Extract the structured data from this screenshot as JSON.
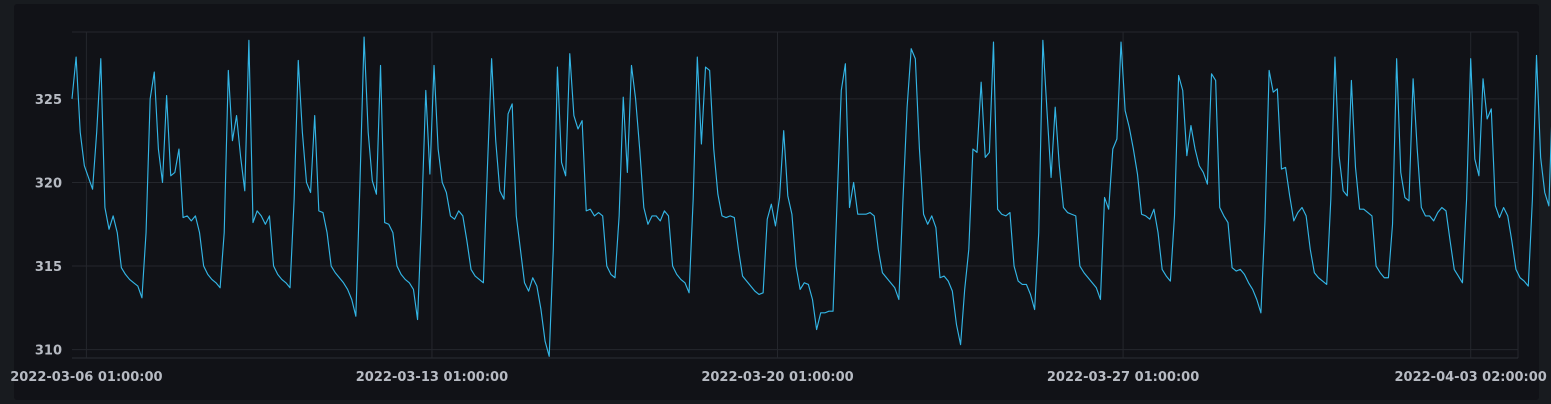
{
  "chart_data": {
    "type": "line",
    "title": "",
    "xlabel": "",
    "ylabel": "",
    "x_range": [
      "2022-03-05T18:00:00",
      "2022-04-04T01:00:00"
    ],
    "ylim": [
      309.5,
      329
    ],
    "y_ticks": [
      "310",
      "315",
      "320",
      "325"
    ],
    "x_ticks": [
      {
        "t": "2022-03-06T01:00:00",
        "label": "2022-03-06 01:00:00"
      },
      {
        "t": "2022-03-13T01:00:00",
        "label": "2022-03-13 01:00:00"
      },
      {
        "t": "2022-03-20T01:00:00",
        "label": "2022-03-20 01:00:00"
      },
      {
        "t": "2022-03-27T01:00:00",
        "label": "2022-03-27 01:00:00"
      },
      {
        "t": "2022-04-03T02:00:00",
        "label": "2022-04-03 02:00:00"
      }
    ],
    "grid": true,
    "line_color": "#33b5e5",
    "series": [
      {
        "sample_interval_hours": 2,
        "start": "2022-03-05T18:00:00",
        "values": [
          325,
          327.5,
          323,
          321,
          320.3,
          319.6,
          323,
          327.4,
          318.5,
          317.2,
          318,
          317,
          314.9,
          314.5,
          314.2,
          314,
          313.8,
          313.1,
          317,
          325,
          326.6,
          322,
          320,
          325.2,
          320.4,
          320.6,
          322,
          317.9,
          318,
          317.7,
          318,
          317,
          315,
          314.5,
          314.2,
          314,
          313.7,
          317,
          326.7,
          322.5,
          324,
          321.5,
          319.5,
          328.5,
          317.6,
          318.3,
          318,
          317.5,
          318,
          315,
          314.5,
          314.2,
          314,
          313.7,
          319,
          327.3,
          323,
          320,
          319.4,
          324,
          318.3,
          318.2,
          317,
          315,
          314.6,
          314.3,
          314,
          313.6,
          313,
          312,
          320,
          328.7,
          323,
          320.1,
          319.3,
          327,
          317.6,
          317.5,
          317,
          315,
          314.5,
          314.2,
          314,
          313.6,
          311.8,
          318,
          325.5,
          320.5,
          327,
          322,
          320,
          319.4,
          318,
          317.8,
          318.3,
          318,
          316.5,
          314.8,
          314.4,
          314.2,
          314,
          321,
          327.4,
          322.5,
          319.5,
          319,
          324.1,
          324.7,
          318,
          316,
          314,
          313.5,
          314.3,
          313.8,
          312.4,
          310.5,
          309.6,
          316,
          326.9,
          321.2,
          320.4,
          327.7,
          324,
          323.2,
          323.7,
          318.3,
          318.4,
          318,
          318.2,
          318,
          315,
          314.5,
          314.3,
          318,
          325.1,
          320.6,
          327,
          325,
          322,
          318.5,
          317.5,
          318,
          318,
          317.7,
          318.3,
          318,
          315,
          314.5,
          314.2,
          314,
          313.4,
          319,
          327.5,
          322.3,
          326.9,
          326.7,
          322,
          319.3,
          318,
          317.9,
          318,
          317.9,
          316,
          314.4,
          314.1,
          313.8,
          313.5,
          313.3,
          313.4,
          317.8,
          318.7,
          317.4,
          319.1,
          323.1,
          319.2,
          318.1,
          315,
          313.6,
          314,
          313.9,
          313,
          311.2,
          312.2,
          312.2,
          312.3,
          312.3,
          319,
          325.5,
          327.1,
          318.5,
          320,
          318.1,
          318.1,
          318.1,
          318.2,
          318,
          316,
          314.6,
          314.3,
          314,
          313.7,
          313,
          319,
          324.5,
          328,
          327.4,
          322,
          318.1,
          317.5,
          318,
          317.3,
          314.3,
          314.4,
          314.1,
          313.5,
          311.5,
          310.3,
          313.6,
          316,
          322,
          321.8,
          326,
          321.5,
          321.8,
          328.4,
          318.4,
          318.1,
          318,
          318.2,
          315,
          314.1,
          313.9,
          313.9,
          313.3,
          312.4,
          317,
          328.5,
          324.3,
          320.3,
          324.5,
          321,
          318.5,
          318.2,
          318.1,
          318,
          315,
          314.6,
          314.3,
          314,
          313.7,
          313,
          319.1,
          318.4,
          322,
          322.6,
          328.4,
          324.3,
          323.3,
          322,
          320.5,
          318.1,
          318,
          317.8,
          318.4,
          317,
          314.8,
          314.4,
          314.1,
          318,
          326.4,
          325.5,
          321.6,
          323.4,
          322,
          321,
          320.6,
          319.9,
          326.5,
          326.1,
          318.5,
          318,
          317.6,
          314.9,
          314.7,
          314.8,
          314.5,
          314,
          313.6,
          313,
          312.2,
          317.7,
          326.7,
          325.4,
          325.6,
          320.8,
          320.9,
          319.2,
          317.7,
          318.2,
          318.5,
          318,
          316,
          314.6,
          314.3,
          314.1,
          313.9,
          319,
          327.5,
          321.6,
          319.5,
          319.2,
          326.1,
          320.9,
          318.4,
          318.4,
          318.2,
          318,
          315,
          314.6,
          314.3,
          314.3,
          317.5,
          327.4,
          320.6,
          319.1,
          318.9,
          326.2,
          322,
          318.5,
          318,
          318,
          317.7,
          318.2,
          318.5,
          318.3,
          316.5,
          314.8,
          314.4,
          314,
          319,
          327.4,
          321.4,
          320.4,
          326.2,
          323.8,
          324.4,
          318.6,
          317.9,
          318.5,
          318,
          316.5,
          314.8,
          314.3,
          314.1,
          313.8,
          319,
          327.6,
          321.5,
          319.4,
          318.6,
          325.8,
          318.8,
          318,
          318.2,
          317.2,
          318.1,
          315,
          314.6,
          314.3,
          314,
          318.5,
          328.3,
          322.5,
          320,
          319.3,
          325,
          319.4,
          318.5,
          318,
          318.4,
          318.3,
          317.8,
          315,
          314.6,
          314.3,
          314,
          316,
          326.5,
          321.1,
          320,
          319.5,
          319.4,
          326,
          322,
          317.7,
          318.4,
          318.2,
          318,
          315.1,
          314.6,
          314.2,
          314,
          313.6,
          320,
          325.9,
          324.3,
          327.3,
          323.7,
          321,
          318.1,
          317.9,
          318.5,
          318.4,
          316,
          314.9,
          314.6,
          313.4,
          314,
          314.6,
          313.8,
          319,
          322.1,
          319.7,
          321,
          320.5,
          319.5,
          315,
          314.2,
          313.9,
          313.5,
          313,
          312.2,
          311.6,
          313,
          314.5,
          326.2,
          325.5,
          322,
          317,
          324.5,
          318.3,
          317.8,
          318,
          318.4,
          318.3,
          317.5,
          315,
          314.6,
          314.2,
          314,
          313.8,
          316,
          316.4,
          317,
          321.4,
          322.4,
          319.5,
          318.6,
          315.5,
          314.6,
          314.3,
          314,
          313.7,
          313.3,
          312.6,
          315.3,
          317.5,
          317.7,
          316.3,
          320.7,
          321.2,
          322,
          317,
          313.3,
          312.9,
          310.9,
          311.7,
          311.8,
          311.8,
          311.7,
          311.7,
          321.8,
          322.5,
          328,
          328.9,
          321.5,
          320.6,
          324,
          324,
          318.3,
          317.9,
          318.5,
          318.4,
          318.1,
          317.8,
          315,
          314.6,
          314.2,
          326.8,
          324.2
        ]
      }
    ]
  }
}
